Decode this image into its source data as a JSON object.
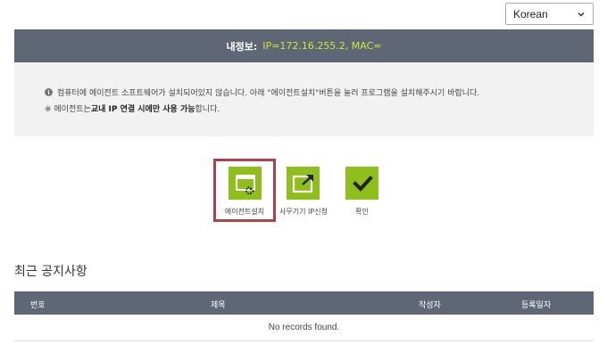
{
  "language_select": {
    "value": "Korean"
  },
  "info_bar": {
    "label": "내정보:",
    "value": "IP=172.16.255.2,   MAC="
  },
  "notice": {
    "line1": "컴퓨터에 에이전트 소프트웨어가 설치되어있지 않습니다. 아래 \"에이전트설치\"버튼을 눌러 프로그램을 설치해주시기 바랍니다.",
    "line2_prefix": "※ 에이전트는 ",
    "line2_bold": "교내 IP 연결 시에만 사용 가능",
    "line2_suffix": "합니다."
  },
  "actions": {
    "install_label": "에이전트설치",
    "ip_request_label": "사무기기 IP신청",
    "confirm_label": "확인"
  },
  "recent_notices": {
    "title": "최근 공지사항",
    "columns": [
      "번호",
      "제목",
      "작성자",
      "등록일자"
    ],
    "empty_text": "No records found."
  },
  "colors": {
    "header_bg": "#5f6675",
    "accent_green": "#8ebf1b",
    "value_yellow": "#d2e834",
    "highlight_red": "#b0404a"
  }
}
